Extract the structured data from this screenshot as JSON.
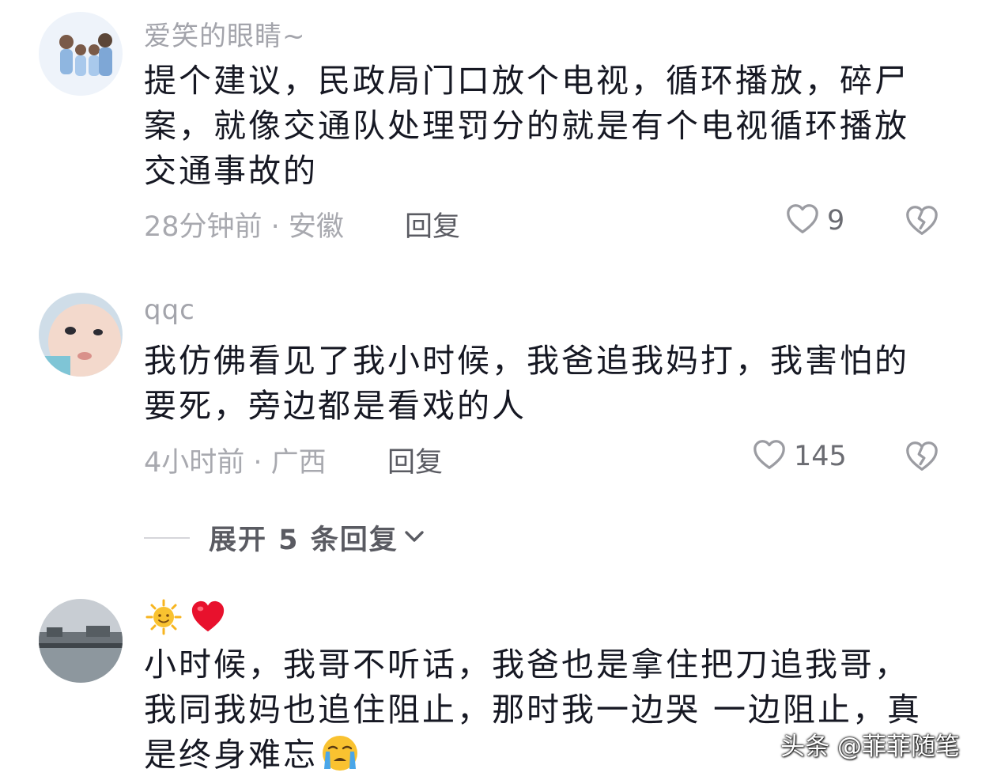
{
  "comments": [
    {
      "username": "爱笑的眼睛~",
      "text": "提个建议，民政局门口放个电视，循环播放，碎尸案，就像交通队处理罚分的就是有个电视循环播放交通事故的",
      "meta": "28分钟前 · 安徽",
      "reply_label": "回复",
      "likes": "9"
    },
    {
      "username": "qqc",
      "text": "我仿佛看见了我小时候，我爸追我妈打，我害怕的要死，旁边都是看戏的人",
      "meta": "4小时前 · 广西",
      "reply_label": "回复",
      "likes": "145"
    },
    {
      "username": "",
      "text": "小时候，我哥不听话，我爸也是拿住把刀追我哥，我同我妈也追住阻止，那时我一边哭 一边阻止，真是终身难忘"
    }
  ],
  "expand": {
    "label": "展开 5 条回复"
  },
  "watermark": "头条 @菲菲随笔",
  "colors": {
    "like_icon": "#9b9ca2",
    "heart_emoji": "#e8112d",
    "sun_emoji": "#f7b520"
  }
}
